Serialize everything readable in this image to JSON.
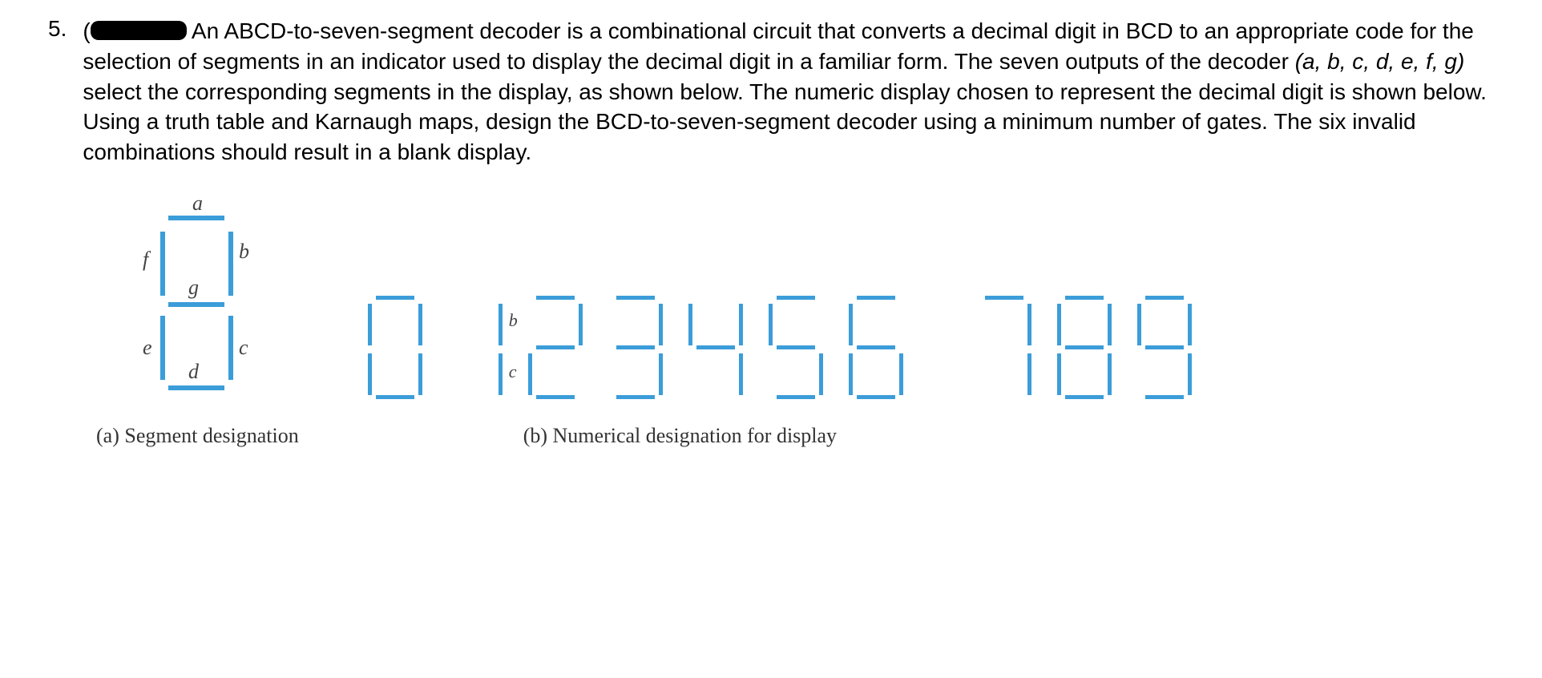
{
  "problem": {
    "number": "5.",
    "paren_open": "(",
    "text_after_redact": " An ABCD-to-seven-segment decoder is a combinational circuit that converts a decimal digit in BCD to an appropriate code for the selection of segments in an indicator used to display the decimal digit in a familiar form. The seven outputs of the decoder ",
    "italic_outputs": "(a, b, c, d, e, f, g)",
    "text_after_outputs": " select the corresponding segments in the display, as shown below. The numeric display chosen to represent the decimal digit is shown below. Using a truth table and Karnaugh maps, design the BCD-to-seven-segment decoder using a minimum number of gates. The six invalid combinations should result in a blank display."
  },
  "figure_a": {
    "caption": "(a) Segment designation",
    "labels": {
      "a": "a",
      "b": "b",
      "c": "c",
      "d": "d",
      "e": "e",
      "f": "f",
      "g": "g"
    }
  },
  "figure_b": {
    "caption": "(b) Numerical designation for display",
    "one_labels": {
      "b": "b",
      "c": "c"
    },
    "digits": [
      {
        "n": 0,
        "segs": [
          "a",
          "b",
          "c",
          "d",
          "e",
          "f"
        ]
      },
      {
        "n": 1,
        "segs": [
          "b",
          "c"
        ]
      },
      {
        "n": 2,
        "segs": [
          "a",
          "b",
          "g",
          "e",
          "d"
        ]
      },
      {
        "n": 3,
        "segs": [
          "a",
          "b",
          "g",
          "c",
          "d"
        ]
      },
      {
        "n": 4,
        "segs": [
          "f",
          "g",
          "b",
          "c"
        ]
      },
      {
        "n": 5,
        "segs": [
          "a",
          "f",
          "g",
          "c",
          "d"
        ]
      },
      {
        "n": 6,
        "segs": [
          "a",
          "f",
          "g",
          "e",
          "c",
          "d"
        ]
      },
      {
        "n": 7,
        "segs": [
          "a",
          "b",
          "c"
        ]
      },
      {
        "n": 8,
        "segs": [
          "a",
          "b",
          "c",
          "d",
          "e",
          "f",
          "g"
        ]
      },
      {
        "n": 9,
        "segs": [
          "a",
          "b",
          "c",
          "d",
          "f",
          "g"
        ]
      }
    ]
  }
}
